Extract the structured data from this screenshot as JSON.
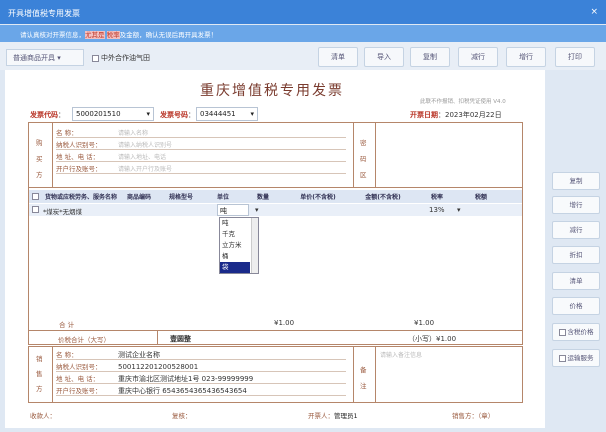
{
  "window": {
    "title": "开具增值税专用发票",
    "close": "×"
  },
  "info": {
    "pre": "请认真核对开票信息，",
    "hl1": "尤其是",
    "hl2": "税率",
    "post": "及金额，确认无误后再开具发票！"
  },
  "toolbar": {
    "type_select": "普通商品开具",
    "checkbox_label": "中外合作油气田",
    "buttons": [
      "清单",
      "导入",
      "复制",
      "减行",
      "增行",
      "打印"
    ]
  },
  "invoice": {
    "title": "重庆增值税专用发票",
    "version": "此联不作报销、扣税凭证使用 V4.0",
    "code_label": "发票代码",
    "code": "5000201510",
    "number_label": "发票号码",
    "number": "03444451",
    "date_label": "开票日期",
    "date": "2023年02月22日",
    "buyer": {
      "side": "购买方",
      "labels": [
        "名    称：",
        "纳税人识别号：",
        "地 址、电 话：",
        "开户行及账号："
      ],
      "placeholders": [
        "请输入名称",
        "请输入纳税人识别号",
        "请输入地址、电话",
        "请输入开户行及账号"
      ]
    },
    "cipher_label": "密码区",
    "columns": [
      "货物或应税劳务、服务名称",
      "商品编码",
      "规格型号",
      "单位",
      "数量",
      "单价(不含税)",
      "金额(不含税)",
      "税率",
      "税额"
    ],
    "row": {
      "name": "*煤炭*无烟煤",
      "unit": "吨",
      "tax_rate": "13%"
    },
    "unit_options": [
      "吨",
      "千克",
      "立方米",
      "桶",
      "袋"
    ],
    "total_label": "合    计",
    "total_amount": "¥1.00",
    "total_tax": "¥1.00",
    "sum_label": "价税合计（大写）",
    "sum_upper": "壹圆整",
    "sum_lower": "（小写）¥1.00",
    "seller": {
      "side": "销售方",
      "labels": [
        "名    称：",
        "纳税人识别号：",
        "地 址、电 话：",
        "开户行及账号："
      ],
      "values": [
        "测试企业名称",
        "500112201200528001",
        "重庆市渝北区测试地址1号 023-99999999",
        "重庆中心银行 6543654365436543654"
      ]
    },
    "remark_label": "备注",
    "remark_placeholder": "请输入备注信息",
    "footer": {
      "payee": "收款人：",
      "reviewer": "复核：",
      "drawer_label": "开票人：",
      "drawer": "管理员1",
      "seller_seal": "销售方：（章）"
    }
  },
  "side_buttons": [
    "复制",
    "增行",
    "减行",
    "折扣",
    "清单",
    "价格",
    "含税价格",
    "运输服务"
  ]
}
